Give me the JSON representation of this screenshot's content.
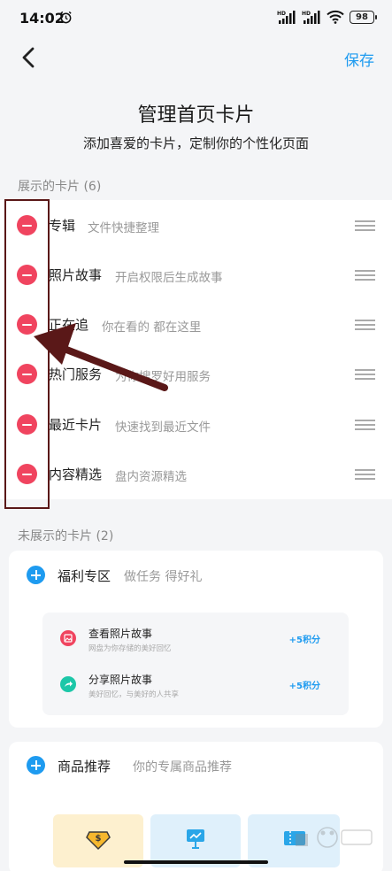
{
  "status_bar": {
    "time": "14:02",
    "signal_1": "HD",
    "signal_2": "HD",
    "battery": "98"
  },
  "header": {
    "save_label": "保存",
    "title": "管理首页卡片",
    "subtitle": "添加喜爱的卡片，定制你的个性化页面"
  },
  "shown_section": {
    "label": "展示的卡片 (6)",
    "cards": [
      {
        "name": "专辑",
        "desc": "文件快捷整理"
      },
      {
        "name": "照片故事",
        "desc": "开启权限后生成故事"
      },
      {
        "name": "正在追",
        "desc": "你在看的 都在这里"
      },
      {
        "name": "热门服务",
        "desc": "为你搜罗好用服务"
      },
      {
        "name": "最近卡片",
        "desc": "快速找到最近文件"
      },
      {
        "name": "内容精选",
        "desc": "盘内资源精选"
      }
    ]
  },
  "hidden_section": {
    "label": "未展示的卡片 (2)",
    "cards": [
      {
        "name": "福利专区",
        "desc": "做任务 得好礼",
        "tasks": [
          {
            "title": "查看照片故事",
            "sub": "网盘为你存储的美好回忆",
            "points": "+5积分",
            "color": "#f0445f"
          },
          {
            "title": "分享照片故事",
            "sub": "美好回忆，与美好的人共享",
            "points": "+5积分",
            "color": "#1cc7a8"
          }
        ]
      },
      {
        "name": "商品推荐",
        "desc": "你的专属商品推荐"
      }
    ]
  },
  "colors": {
    "accent": "#1e9bf0",
    "remove": "#f0445f",
    "annotation": "#5a1818"
  }
}
